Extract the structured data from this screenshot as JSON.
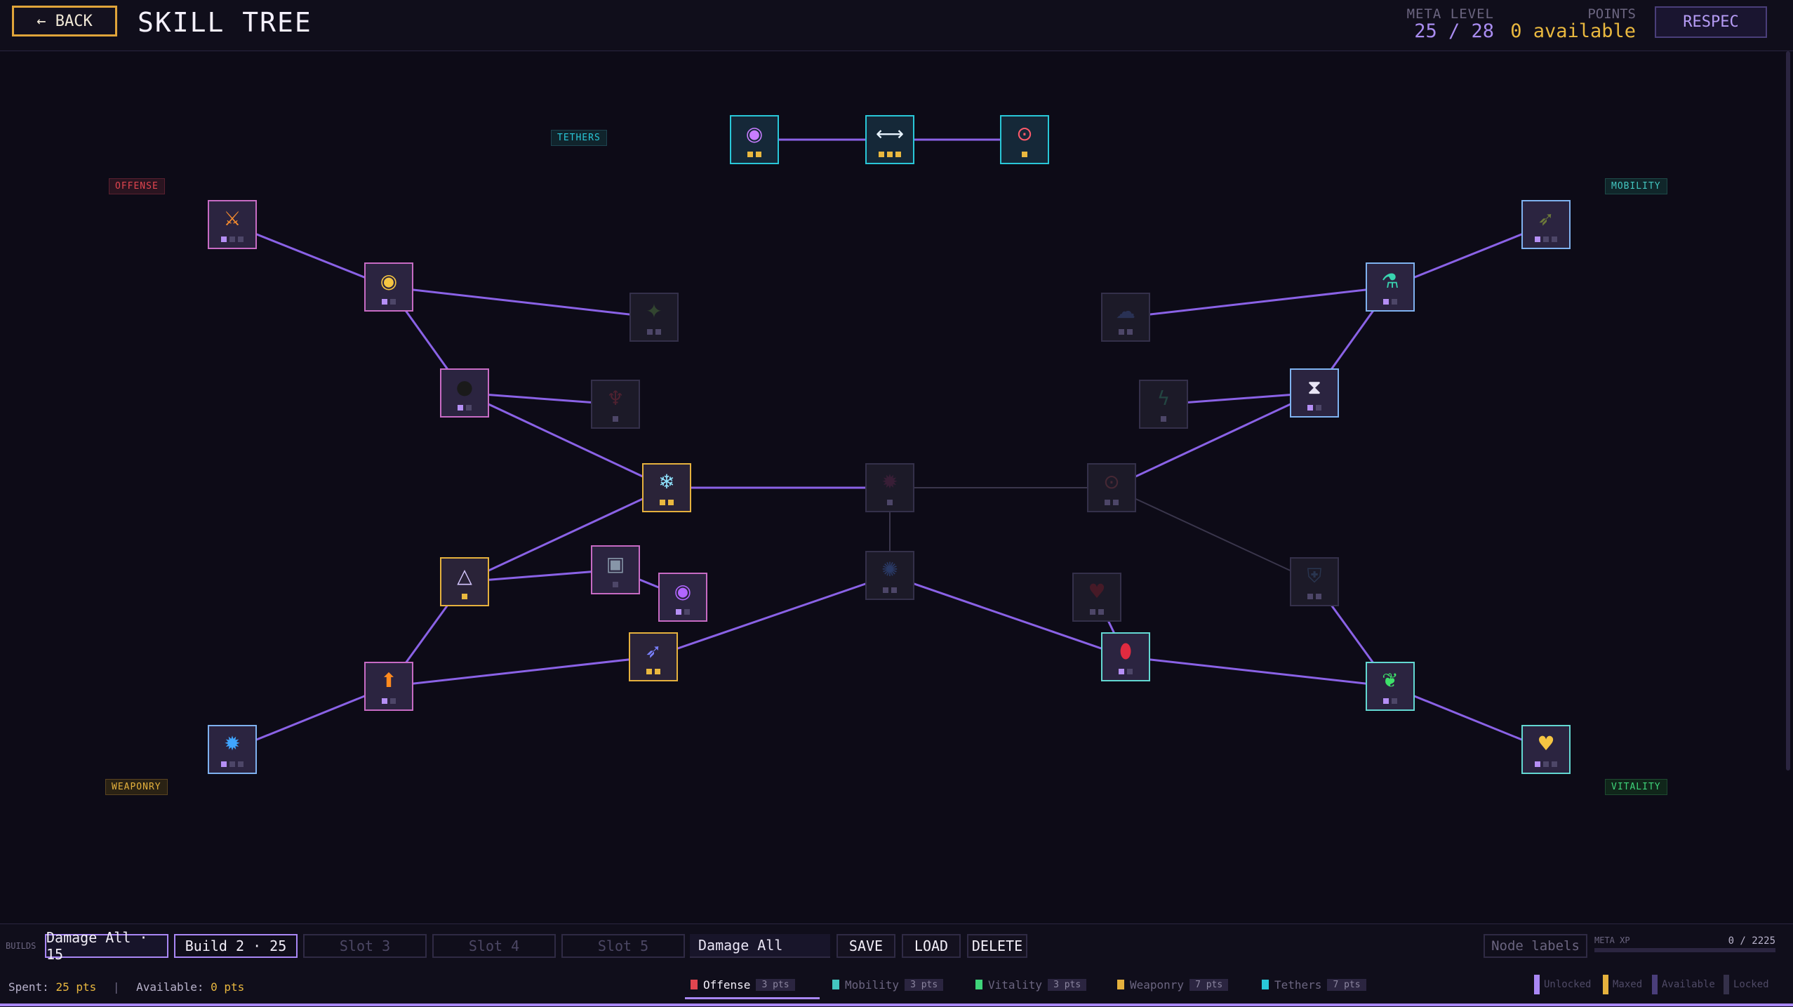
{
  "header": {
    "back_label": "← BACK",
    "title": "SKILL TREE",
    "meta_level_label": "META LEVEL",
    "meta_level_value": "25 / 28",
    "points_label": "POINTS",
    "points_value": "0 available",
    "respec_label": "RESPEC"
  },
  "branches": {
    "offense": "OFFENSE",
    "mobility": "MOBILITY",
    "weaponry": "WEAPONRY",
    "vitality": "VITALITY",
    "tethers": "TETHERS"
  },
  "colors": {
    "unlocked": "#a987f5",
    "maxed": "#e5b13d",
    "available": "#4a3e7a",
    "locked": "#34304a",
    "offense": "#e0454f",
    "mobility": "#43c6c0",
    "vitality": "#3fd47a",
    "weaponry": "#e5b13d",
    "tethers": "#29c7d8"
  },
  "nodes": [
    {
      "id": "tether-orb",
      "icon": "purple-orb-icon",
      "glyph": "◉",
      "color": "#c77dff",
      "state": "tether",
      "pips": "gg"
    },
    {
      "id": "tether-link",
      "icon": "tether-link-icon",
      "glyph": "⟷",
      "color": "#e8f4ff",
      "state": "tether",
      "pips": "ggg"
    },
    {
      "id": "tether-ring",
      "icon": "red-ring-icon",
      "glyph": "⊙",
      "color": "#ff5a6a",
      "state": "tether",
      "pips": "g"
    },
    {
      "id": "crossed-swords",
      "icon": "crossed-swords-icon",
      "glyph": "⚔",
      "color": "#f28a2e",
      "state": "offense",
      "pips": "onn"
    },
    {
      "id": "eye",
      "icon": "eye-icon",
      "glyph": "◉",
      "color": "#f5c542",
      "state": "offense",
      "pips": "on"
    },
    {
      "id": "bomb",
      "icon": "bomb-icon",
      "glyph": "●",
      "color": "#1a1a1a",
      "state": "offense",
      "pips": "on"
    },
    {
      "id": "green-sigil",
      "icon": "green-sigil-icon",
      "glyph": "✦",
      "color": "#4e7a3a",
      "state": "locked",
      "pips": "nn"
    },
    {
      "id": "red-horn",
      "icon": "horn-icon",
      "glyph": "♆",
      "color": "#8a2b3a",
      "state": "locked",
      "pips": "n"
    },
    {
      "id": "snowflake",
      "icon": "snowflake-icon",
      "glyph": "❄",
      "color": "#8fe3ff",
      "state": "maxed",
      "pips": "gg"
    },
    {
      "id": "core-center",
      "icon": "dark-core-icon",
      "glyph": "✹",
      "color": "#5a2448",
      "state": "locked",
      "pips": "n"
    },
    {
      "id": "red-ring-mid",
      "icon": "red-ring-icon",
      "glyph": "⊙",
      "color": "#7a3a44",
      "state": "locked",
      "pips": "nn"
    },
    {
      "id": "shockwave",
      "icon": "shockwave-icon",
      "glyph": "✺",
      "color": "#3a5fae",
      "state": "locked",
      "pips": "nn"
    },
    {
      "id": "triangle-net",
      "icon": "triangle-network-icon",
      "glyph": "△",
      "color": "#d6c7ff",
      "state": "maxed",
      "pips": "g"
    },
    {
      "id": "stone-block",
      "icon": "stone-block-icon",
      "glyph": "▣",
      "color": "#8796a8",
      "state": "offense",
      "pips": "n"
    },
    {
      "id": "vortex",
      "icon": "vortex-icon",
      "glyph": "◉",
      "color": "#b266ff",
      "state": "offense",
      "pips": "on"
    },
    {
      "id": "crystal-blade",
      "icon": "crystal-blade-icon",
      "glyph": "➶",
      "color": "#7a80ff",
      "state": "maxed",
      "pips": "gg"
    },
    {
      "id": "orange-arrow",
      "icon": "up-arrow-icon",
      "glyph": "⬆",
      "color": "#ff8a1e",
      "state": "offense",
      "pips": "on"
    },
    {
      "id": "blue-gear",
      "icon": "blue-gear-icon",
      "glyph": "✹",
      "color": "#3fa5ff",
      "state": "mobility",
      "pips": "onn"
    },
    {
      "id": "bird",
      "icon": "bird-icon",
      "glyph": "➶",
      "color": "#6d7a3a",
      "state": "mobility",
      "pips": "onn"
    },
    {
      "id": "potion",
      "icon": "potion-icon",
      "glyph": "⚗",
      "color": "#39d4b0",
      "state": "mobility",
      "pips": "on"
    },
    {
      "id": "blue-cloud",
      "icon": "cloud-icon",
      "glyph": "☁",
      "color": "#3a4e8a",
      "state": "locked",
      "pips": "nn"
    },
    {
      "id": "hourglass",
      "icon": "hourglass-icon",
      "glyph": "⧗",
      "color": "#e8e4f4",
      "state": "mobility",
      "pips": "on"
    },
    {
      "id": "lightning",
      "icon": "lightning-icon",
      "glyph": "ϟ",
      "color": "#2c7a62",
      "state": "locked",
      "pips": "n"
    },
    {
      "id": "shield",
      "icon": "shield-icon",
      "glyph": "⛨",
      "color": "#3a5680",
      "state": "locked",
      "pips": "nn"
    },
    {
      "id": "heart-crack",
      "icon": "broken-heart-icon",
      "glyph": "♥",
      "color": "#7a1a26",
      "state": "locked",
      "pips": "nn"
    },
    {
      "id": "blood-drop",
      "icon": "blood-drop-icon",
      "glyph": "⬮",
      "color": "#e02b40",
      "state": "vitality",
      "pips": "on"
    },
    {
      "id": "leaf",
      "icon": "leaf-icon",
      "glyph": "❦",
      "color": "#3ee06a",
      "state": "vitality",
      "pips": "on"
    },
    {
      "id": "gold-heart",
      "icon": "gold-heart-icon",
      "glyph": "♥",
      "color": "#f5c542",
      "state": "vitality",
      "pips": "onn"
    }
  ],
  "footer": {
    "builds_label": "BUILDS",
    "slots": [
      {
        "label": "Damage All · 15",
        "state": "active"
      },
      {
        "label": "Build 2 · 25",
        "state": "filled"
      },
      {
        "label": "Slot 3",
        "state": "empty"
      },
      {
        "label": "Slot 4",
        "state": "empty"
      },
      {
        "label": "Slot 5",
        "state": "empty"
      }
    ],
    "build_name_value": "Damage All",
    "save_label": "SAVE",
    "load_label": "LOAD",
    "delete_label": "DELETE",
    "node_labels_toggle": "Node labels",
    "meta_xp_label": "META XP",
    "meta_xp_value": "0 / 2225",
    "meta_xp_progress": 0,
    "spent_label": "Spent:",
    "spent_value": "25 pts",
    "available_label": "Available:",
    "available_value": "0 pts",
    "tabs": [
      {
        "name": "Offense",
        "count": "3 pts",
        "color": "#e0454f",
        "active": true
      },
      {
        "name": "Mobility",
        "count": "3 pts",
        "color": "#43c6c0",
        "active": false
      },
      {
        "name": "Vitality",
        "count": "3 pts",
        "color": "#3fd47a",
        "active": false
      },
      {
        "name": "Weaponry",
        "count": "7 pts",
        "color": "#e5b13d",
        "active": false
      },
      {
        "name": "Tethers",
        "count": "7 pts",
        "color": "#29c7d8",
        "active": false
      }
    ],
    "legend": {
      "unlocked": "Unlocked",
      "maxed": "Maxed",
      "available": "Available",
      "locked": "Locked"
    }
  }
}
